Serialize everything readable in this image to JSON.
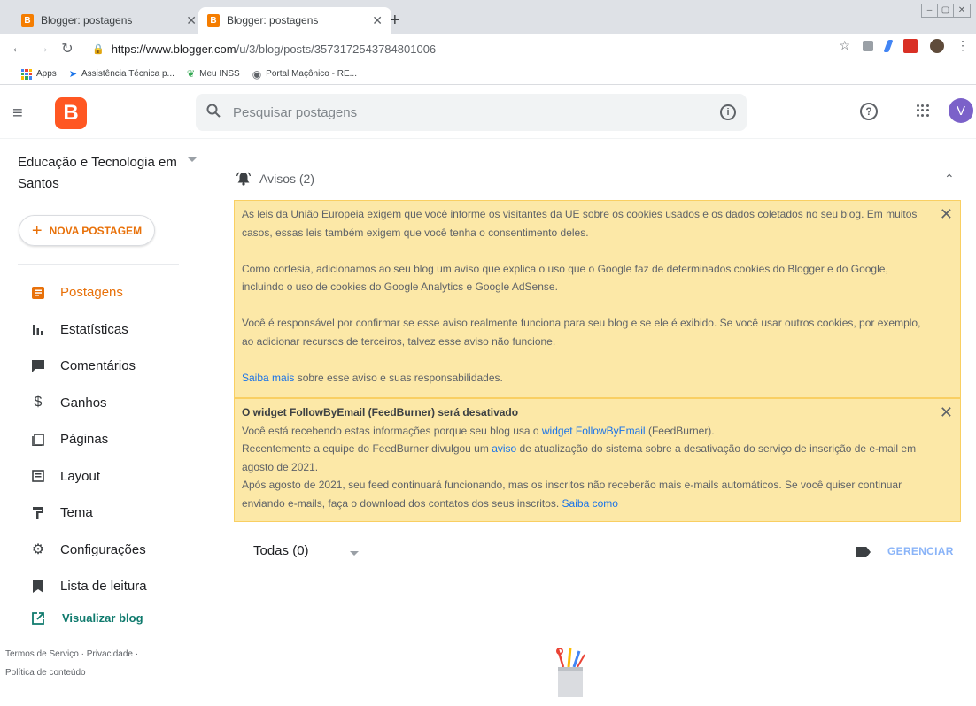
{
  "browser": {
    "tabs": [
      {
        "title": "Blogger: postagens",
        "active": false
      },
      {
        "title": "Blogger: postagens",
        "active": true
      }
    ],
    "url_host": "https://www.blogger.com",
    "url_path": "/u/3/blog/posts/3573172543784801006",
    "bookmarks": [
      "Apps",
      "Assistência Técnica p...",
      "Meu INSS",
      "Portal Maçônico - RE..."
    ]
  },
  "header": {
    "search_placeholder": "Pesquisar postagens",
    "avatar_letter": "V"
  },
  "sidebar": {
    "blog_name": "Educação e Tecnologia em Santos",
    "new_post_label": "NOVA POSTAGEM",
    "items": [
      {
        "label": "Postagens",
        "icon": "posts-icon",
        "active": true
      },
      {
        "label": "Estatísticas",
        "icon": "stats-icon",
        "active": false
      },
      {
        "label": "Comentários",
        "icon": "comments-icon",
        "active": false
      },
      {
        "label": "Ganhos",
        "icon": "dollar-icon",
        "active": false
      },
      {
        "label": "Páginas",
        "icon": "pages-icon",
        "active": false
      },
      {
        "label": "Layout",
        "icon": "layout-icon",
        "active": false
      },
      {
        "label": "Tema",
        "icon": "theme-icon",
        "active": false
      },
      {
        "label": "Configurações",
        "icon": "gear-icon",
        "active": false
      },
      {
        "label": "Lista de leitura",
        "icon": "bookmark-icon",
        "active": false
      }
    ],
    "view_blog_label": "Visualizar blog",
    "footer": {
      "terms": "Termos de Serviço",
      "privacy": "Privacidade",
      "content_policy": "Política de conteúdo",
      "sep": "·"
    }
  },
  "main": {
    "avisos_title": "Avisos (2)",
    "notice1": {
      "p1": "As leis da União Europeia exigem que você informe os visitantes da UE sobre os cookies usados e os dados coletados no seu blog. Em muitos casos, essas leis também exigem que você tenha o consentimento deles.",
      "p2": "Como cortesia, adicionamos ao seu blog um aviso que explica o uso que o Google faz de determinados cookies do Blogger e do Google, incluindo o uso de cookies do Google Analytics e Google AdSense.",
      "p3": "Você é responsável por confirmar se esse aviso realmente funciona para seu blog e se ele é exibido. Se você usar outros cookies, por exemplo, ao adicionar recursos de terceiros, talvez esse aviso não funcione.",
      "link": "Saiba mais",
      "link_tail": " sobre esse aviso e suas responsabilidades."
    },
    "notice2": {
      "title": "O widget FollowByEmail (FeedBurner) será desativado",
      "l1a": "Você está recebendo estas informações porque seu blog usa o ",
      "l1link": "widget FollowByEmail",
      "l1b": " (FeedBurner).",
      "l2a": "Recentemente a equipe do FeedBurner divulgou um ",
      "l2link": "aviso",
      "l2b": " de atualização do sistema sobre a desativação do serviço de inscrição de e-mail em agosto de 2021.",
      "l3": "Após agosto de 2021, seu feed continuará funcionando, mas os inscritos não receberão mais e-mails automáticos. Se você quiser continuar enviando e-mails, faça o download dos contatos dos seus inscritos. ",
      "l3link": "Saiba como"
    },
    "filter_label": "Todas (0)",
    "manage_label": "GERENCIAR"
  },
  "colors": {
    "accent": "#e8710a",
    "notice_bg": "#fce8a7",
    "link": "#1a73e8"
  }
}
